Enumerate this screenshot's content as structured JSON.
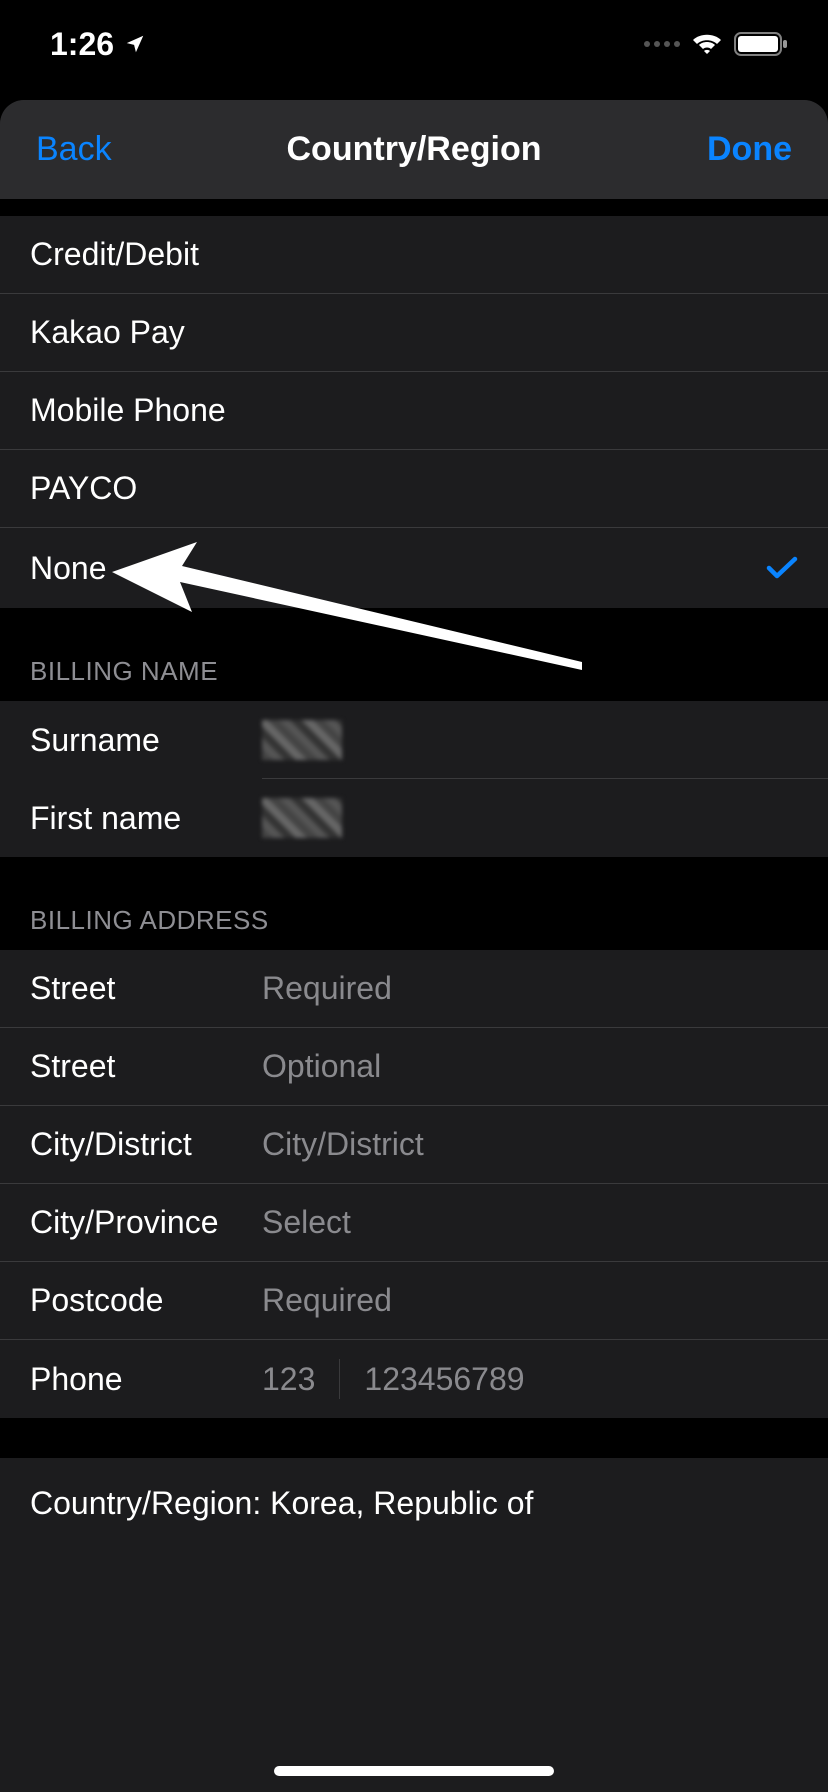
{
  "status": {
    "time": "1:26"
  },
  "header": {
    "back": "Back",
    "title": "Country/Region",
    "done": "Done"
  },
  "payment": {
    "options": [
      "Credit/Debit",
      "Kakao Pay",
      "Mobile Phone",
      "PAYCO",
      "None"
    ],
    "selected": "None"
  },
  "billing_name": {
    "header": "BILLING NAME",
    "surname_label": "Surname",
    "firstname_label": "First name"
  },
  "billing_address": {
    "header": "BILLING ADDRESS",
    "street1_label": "Street",
    "street1_placeholder": "Required",
    "street2_label": "Street",
    "street2_placeholder": "Optional",
    "city_label": "City/District",
    "city_placeholder": "City/District",
    "province_label": "City/Province",
    "province_placeholder": "Select",
    "postcode_label": "Postcode",
    "postcode_placeholder": "Required",
    "phone_label": "Phone",
    "phone_prefix": "123",
    "phone_placeholder": "123456789"
  },
  "country_region": {
    "label": "Country/Region: Korea, Republic of"
  }
}
